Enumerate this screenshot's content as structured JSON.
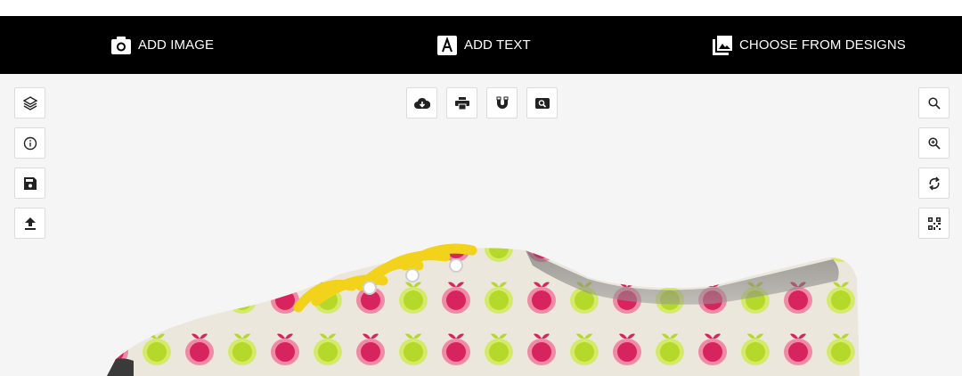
{
  "topbar": {
    "tabs": [
      {
        "label": "ADD IMAGE",
        "icon": "camera-icon"
      },
      {
        "label": "ADD TEXT",
        "icon": "text-icon"
      },
      {
        "label": "CHOOSE FROM DESIGNS",
        "icon": "gallery-icon"
      }
    ]
  },
  "left_tools": [
    {
      "icon": "layers-icon"
    },
    {
      "icon": "info-icon"
    },
    {
      "icon": "save-icon"
    },
    {
      "icon": "upload-icon"
    }
  ],
  "center_tools": [
    {
      "icon": "cloud-download-icon"
    },
    {
      "icon": "print-icon"
    },
    {
      "icon": "magnet-icon"
    },
    {
      "icon": "preview-search-icon"
    }
  ],
  "right_tools": [
    {
      "icon": "search-icon"
    },
    {
      "icon": "zoom-in-icon"
    },
    {
      "icon": "refresh-icon"
    },
    {
      "icon": "qr-code-icon"
    }
  ],
  "colors": {
    "topbar": "#000000",
    "canvas": "#f5f5f5",
    "shoe_fabric": "#ece7dc",
    "apple_red": "#d8245e",
    "apple_green": "#b5d82a",
    "laces": "#f2d21a"
  }
}
